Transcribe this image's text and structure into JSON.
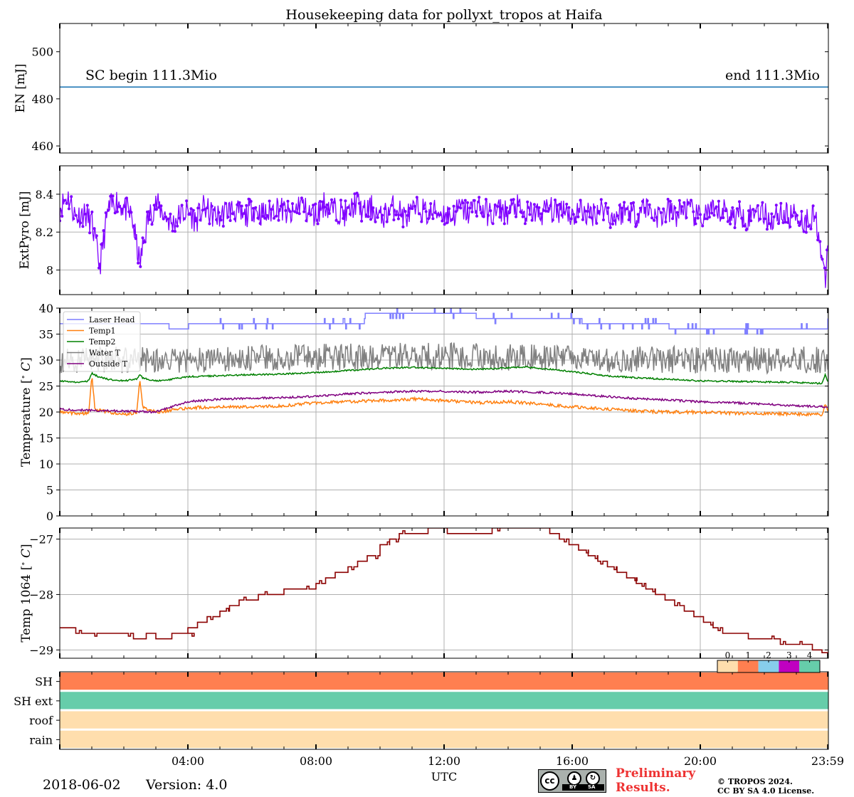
{
  "title": "Housekeeping data for pollyxt_tropos at Haifa",
  "footer": {
    "date": "2018-06-02",
    "version": "Version: 4.0",
    "preliminary_line1": "Preliminary",
    "preliminary_line2": "Results.",
    "copyright_line1": "© TROPOS 2024.",
    "copyright_line2": "CC BY SA 4.0 License.",
    "cc_icon": "cc-by-sa-badge",
    "cc_label": "cc",
    "by_label": "BY",
    "sa_label": "SA"
  },
  "colors": {
    "en": "#1f77b4",
    "extpyro": "#8000ff",
    "laser_head": "#7f7fff",
    "temp1": "#ff7f0e",
    "temp2": "#008000",
    "water_t": "#808080",
    "outside_t": "#800080",
    "temp1064": "#8b0000",
    "status0": "#ffdead",
    "status1": "#ff7f50",
    "status2": "#87ceeb",
    "status3": "#c000c0",
    "status4": "#66cdaa",
    "grid": "#b0b0b0"
  },
  "chart_data": [
    {
      "type": "line",
      "ylabel": "EN [mJ]",
      "ylim": [
        457,
        512
      ],
      "yticks": [
        460,
        480,
        500
      ],
      "xlim": [
        0,
        24
      ],
      "grid": false,
      "annotations": [
        "SC begin 111.3Mio",
        "end 111.3Mio"
      ],
      "series": [
        {
          "x": [
            0,
            24
          ],
          "values": [
            485,
            485
          ]
        }
      ]
    },
    {
      "type": "line",
      "ylabel": "ExtPyro [mJ]",
      "ylim": [
        7.87,
        8.55
      ],
      "yticks": [
        8.0,
        8.2,
        8.4
      ],
      "xlim": [
        0,
        24
      ],
      "grid": true,
      "marker": "dot",
      "series": [
        {
          "x": [
            0.0,
            0.25,
            0.5,
            0.75,
            1.0,
            1.25,
            1.5,
            1.75,
            2.0,
            2.25,
            2.5,
            2.75,
            3.0,
            3.25,
            3.5,
            3.75,
            4.0,
            4.25,
            4.5,
            4.75,
            5.0,
            5.25,
            5.5,
            5.75,
            6.0,
            6.25,
            6.5,
            6.75,
            7.0,
            7.25,
            7.5,
            7.75,
            8.0,
            8.25,
            8.5,
            8.75,
            9.0,
            9.25,
            9.5,
            9.75,
            10.0,
            10.25,
            10.5,
            10.75,
            11.0,
            11.25,
            11.5,
            11.75,
            12.0,
            12.25,
            12.5,
            12.75,
            13.0,
            13.25,
            13.5,
            13.75,
            14.0,
            14.25,
            14.5,
            14.75,
            15.0,
            15.25,
            15.5,
            15.75,
            16.0,
            16.25,
            16.5,
            16.75,
            17.0,
            17.25,
            17.5,
            17.75,
            18.0,
            18.25,
            18.5,
            18.75,
            19.0,
            19.25,
            19.5,
            19.75,
            20.0,
            20.25,
            20.5,
            20.75,
            21.0,
            21.25,
            21.5,
            21.75,
            22.0,
            22.25,
            22.5,
            22.75,
            23.0,
            23.25,
            23.5,
            23.6,
            23.7,
            23.8,
            23.9,
            23.98
          ],
          "values": [
            8.33,
            8.39,
            8.28,
            8.3,
            8.25,
            8.02,
            8.31,
            8.37,
            8.33,
            8.28,
            8.03,
            8.27,
            8.35,
            8.3,
            8.24,
            8.29,
            8.31,
            8.26,
            8.33,
            8.29,
            8.28,
            8.32,
            8.31,
            8.27,
            8.33,
            8.3,
            8.29,
            8.34,
            8.31,
            8.28,
            8.36,
            8.3,
            8.29,
            8.35,
            8.32,
            8.31,
            8.29,
            8.36,
            8.3,
            8.33,
            8.27,
            8.31,
            8.34,
            8.28,
            8.3,
            8.33,
            8.29,
            8.31,
            8.3,
            8.28,
            8.33,
            8.3,
            8.35,
            8.31,
            8.29,
            8.32,
            8.3,
            8.34,
            8.28,
            8.31,
            8.29,
            8.33,
            8.3,
            8.34,
            8.28,
            8.32,
            8.29,
            8.31,
            8.33,
            8.27,
            8.3,
            8.32,
            8.29,
            8.34,
            8.3,
            8.28,
            8.31,
            8.29,
            8.33,
            8.3,
            8.27,
            8.31,
            8.29,
            8.32,
            8.28,
            8.3,
            8.27,
            8.33,
            8.29,
            8.26,
            8.31,
            8.28,
            8.3,
            8.25,
            8.29,
            8.27,
            8.2,
            8.05,
            7.92,
            8.15
          ],
          "noise": 0.07
        }
      ]
    },
    {
      "type": "line",
      "ylabel": "Temperature [$^\\circ C$]",
      "ylim": [
        0,
        40
      ],
      "yticks": [
        0,
        5,
        10,
        15,
        20,
        25,
        30,
        35,
        40
      ],
      "xlim": [
        0,
        24
      ],
      "grid": true,
      "legend_position": "top-left",
      "series": [
        {
          "name": "Laser Head",
          "colorKey": "laser_head",
          "noise": 0.0,
          "step": true,
          "x": [
            0.0,
            0.5,
            1.0,
            1.5,
            2.0,
            2.5,
            3.0,
            3.4,
            3.6,
            4.0,
            5.0,
            6.0,
            7.0,
            8.0,
            9.0,
            9.5,
            10.0,
            11.0,
            12.0,
            13.0,
            14.0,
            15.0,
            16.0,
            16.3,
            17.0,
            18.0,
            19.0,
            20.0,
            21.0,
            22.0,
            23.0,
            23.9,
            23.98
          ],
          "values": [
            37,
            37,
            37,
            37,
            37,
            37,
            37,
            36,
            36,
            37,
            37,
            37,
            37,
            37,
            37,
            39,
            39,
            39,
            39,
            38,
            38,
            38,
            38,
            37,
            37,
            37,
            36,
            36,
            36,
            36,
            36,
            36,
            38
          ]
        },
        {
          "name": "Temp1",
          "colorKey": "temp1",
          "noise": 0.3,
          "x": [
            0.0,
            0.5,
            0.9,
            1.0,
            1.1,
            1.5,
            2.0,
            2.4,
            2.5,
            2.6,
            3.0,
            3.5,
            4.0,
            5.0,
            6.0,
            7.0,
            8.0,
            9.0,
            10.0,
            11.0,
            12.0,
            13.0,
            14.0,
            15.0,
            16.0,
            17.0,
            18.0,
            19.0,
            20.0,
            21.0,
            22.0,
            23.0,
            23.8,
            23.9,
            23.98
          ],
          "values": [
            20,
            19.7,
            19.8,
            27.0,
            20.5,
            20.0,
            19.6,
            19.8,
            26.0,
            20.8,
            20.0,
            20.3,
            20.8,
            21.0,
            21.0,
            21.2,
            21.8,
            22.0,
            22.2,
            22.5,
            22.2,
            21.8,
            22.0,
            21.5,
            21.0,
            20.6,
            20.2,
            20.0,
            20.0,
            19.8,
            19.7,
            19.6,
            19.5,
            21.5,
            20.5
          ]
        },
        {
          "name": "Temp2",
          "colorKey": "temp2",
          "noise": 0.15,
          "x": [
            0.0,
            0.5,
            0.9,
            1.0,
            1.2,
            1.5,
            2.0,
            2.4,
            2.5,
            2.6,
            3.0,
            3.5,
            4.0,
            5.0,
            6.0,
            7.0,
            8.0,
            9.0,
            10.0,
            11.0,
            12.0,
            13.0,
            14.0,
            14.5,
            15.0,
            16.0,
            17.0,
            18.0,
            19.0,
            20.0,
            21.0,
            22.0,
            23.0,
            23.8,
            23.9,
            23.98
          ],
          "values": [
            26.0,
            25.7,
            26.0,
            27.5,
            26.8,
            26.3,
            26.0,
            26.3,
            27.2,
            26.5,
            26.0,
            26.3,
            26.8,
            27.0,
            27.2,
            27.3,
            27.6,
            28.0,
            28.4,
            28.6,
            28.4,
            28.2,
            28.5,
            28.7,
            28.4,
            27.8,
            27.0,
            26.6,
            26.3,
            26.0,
            25.9,
            25.8,
            25.7,
            25.5,
            27.2,
            26.0
          ]
        },
        {
          "name": "Water T",
          "colorKey": "water_t",
          "noise": 2.6,
          "x": [
            0.0,
            2.5,
            3.0,
            4.0,
            8.0,
            12.0,
            16.0,
            20.0,
            23.98
          ],
          "values": [
            30,
            30,
            30.2,
            30.0,
            30.5,
            30.8,
            30.2,
            30.0,
            30.0
          ]
        },
        {
          "name": "Outside T",
          "colorKey": "outside_t",
          "noise": 0.2,
          "x": [
            0.0,
            1.0,
            2.0,
            3.0,
            3.5,
            4.0,
            5.0,
            6.0,
            7.0,
            8.0,
            9.0,
            10.0,
            11.0,
            12.0,
            13.0,
            14.0,
            15.0,
            16.0,
            17.0,
            18.0,
            19.0,
            20.0,
            21.0,
            22.0,
            23.0,
            23.98
          ],
          "values": [
            20.5,
            20.3,
            20.2,
            20.0,
            21.0,
            22.0,
            22.5,
            22.6,
            22.8,
            23.0,
            23.5,
            23.8,
            24.0,
            24.0,
            23.8,
            24.0,
            23.8,
            23.5,
            23.0,
            22.6,
            22.3,
            22.0,
            21.8,
            21.5,
            21.2,
            21.0
          ]
        }
      ]
    },
    {
      "type": "line",
      "ylabel": "Temp 1064 [$^\\circ C$]",
      "ylim": [
        -29.15,
        -26.8
      ],
      "yticks": [
        -29,
        -28,
        -27
      ],
      "xlim": [
        0,
        24
      ],
      "grid": true,
      "step": true,
      "series": [
        {
          "x": [
            0.0,
            0.5,
            1.0,
            1.5,
            2.0,
            2.3,
            2.7,
            3.0,
            3.5,
            3.9,
            4.0,
            4.3,
            4.6,
            5.0,
            5.3,
            5.6,
            5.9,
            6.2,
            6.5,
            7.0,
            7.5,
            8.0,
            8.3,
            8.6,
            9.0,
            9.3,
            9.6,
            10.0,
            10.3,
            10.6,
            11.0,
            11.5,
            12.0,
            12.1,
            12.5,
            13.0,
            13.5,
            14.0,
            14.5,
            15.0,
            15.3,
            15.6,
            15.9,
            16.2,
            16.5,
            16.8,
            17.1,
            17.4,
            17.7,
            18.0,
            18.3,
            18.6,
            18.9,
            19.2,
            19.5,
            19.8,
            20.1,
            20.4,
            20.7,
            21.0,
            21.5,
            22.0,
            22.5,
            23.0,
            23.5,
            23.8,
            23.98
          ],
          "values": [
            -28.6,
            -28.7,
            -28.7,
            -28.7,
            -28.7,
            -28.8,
            -28.7,
            -28.8,
            -28.7,
            -28.7,
            -28.6,
            -28.5,
            -28.4,
            -28.3,
            -28.2,
            -28.1,
            -28.1,
            -28.0,
            -28.0,
            -27.9,
            -27.9,
            -27.8,
            -27.7,
            -27.6,
            -27.5,
            -27.4,
            -27.3,
            -27.1,
            -27.0,
            -26.9,
            -26.9,
            -26.8,
            -26.8,
            -26.9,
            -26.9,
            -26.9,
            -26.8,
            -26.8,
            -26.8,
            -26.8,
            -26.9,
            -27.0,
            -27.1,
            -27.2,
            -27.3,
            -27.4,
            -27.5,
            -27.6,
            -27.7,
            -27.8,
            -27.9,
            -28.0,
            -28.1,
            -28.2,
            -28.3,
            -28.4,
            -28.5,
            -28.6,
            -28.7,
            -28.7,
            -28.8,
            -28.8,
            -28.9,
            -28.9,
            -29.0,
            -29.05,
            -29.1
          ]
        }
      ]
    },
    {
      "type": "heatmap",
      "rows": [
        "SH",
        "SH ext",
        "roof",
        "rain"
      ],
      "row_values": [
        1,
        4,
        0,
        0
      ],
      "colorbar_ticks": [
        "0",
        "1",
        "2",
        "3",
        "4"
      ],
      "xlim": [
        0,
        24
      ],
      "xlabel": "UTC",
      "xticks": [
        "04:00",
        "08:00",
        "12:00",
        "16:00",
        "20:00",
        "23:59"
      ]
    }
  ]
}
